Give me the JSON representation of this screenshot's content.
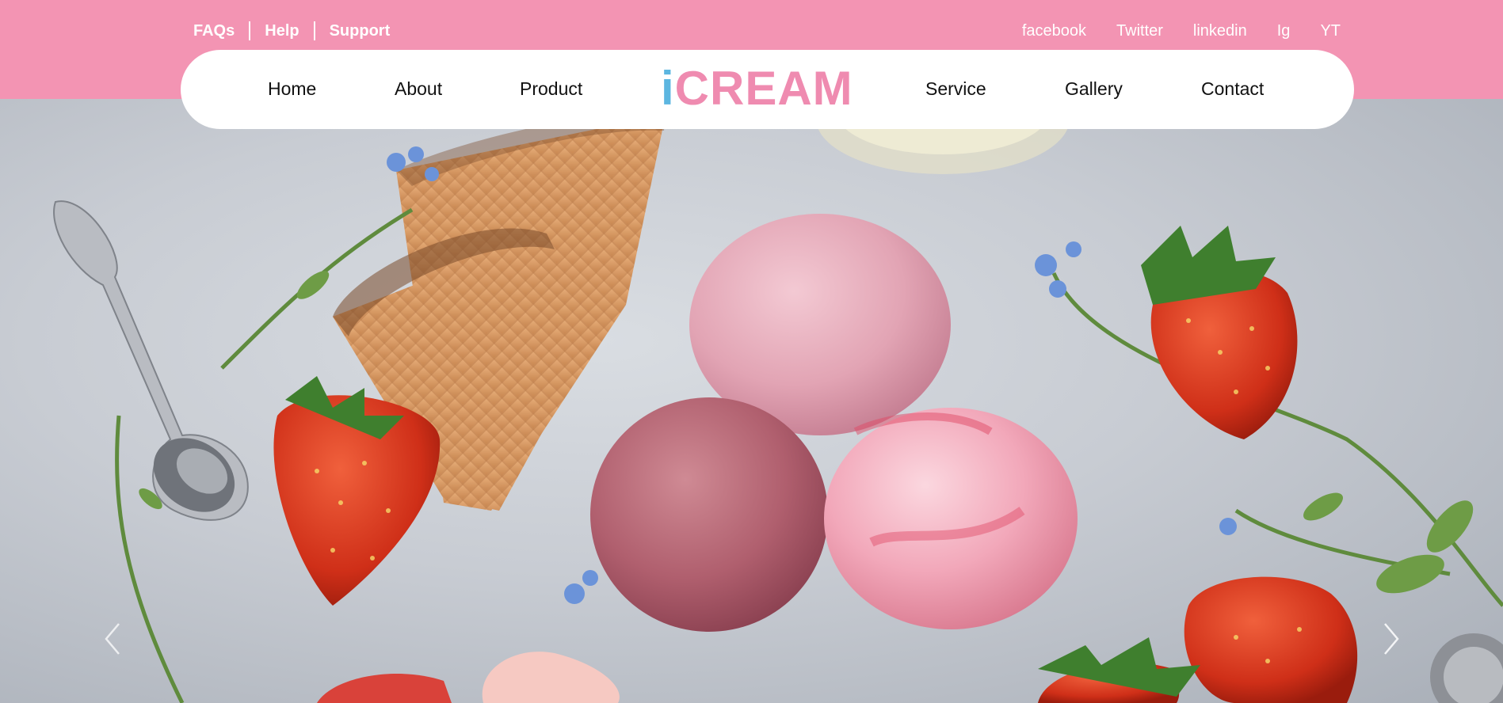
{
  "top_links_left": [
    {
      "label": "FAQs"
    },
    {
      "label": "Help"
    },
    {
      "label": "Support"
    }
  ],
  "top_links_right": [
    {
      "label": "facebook"
    },
    {
      "label": "Twitter"
    },
    {
      "label": "linkedin"
    },
    {
      "label": "Ig"
    },
    {
      "label": "YT"
    }
  ],
  "nav": {
    "items": [
      {
        "label": "Home"
      },
      {
        "label": "About"
      },
      {
        "label": "Product"
      },
      {
        "label": "Service"
      },
      {
        "label": "Gallery"
      },
      {
        "label": "Contact"
      }
    ],
    "logo_i": "i",
    "logo_rest": "CREAM"
  },
  "colors": {
    "topbar": "#f394b3",
    "logo_i": "#5cb6e0",
    "logo_rest": "#ef8bb0"
  },
  "hero": {
    "image": "ice cream scoops with waffle cones and strawberries",
    "prev_icon": "chevron-left-icon",
    "next_icon": "chevron-right-icon"
  }
}
